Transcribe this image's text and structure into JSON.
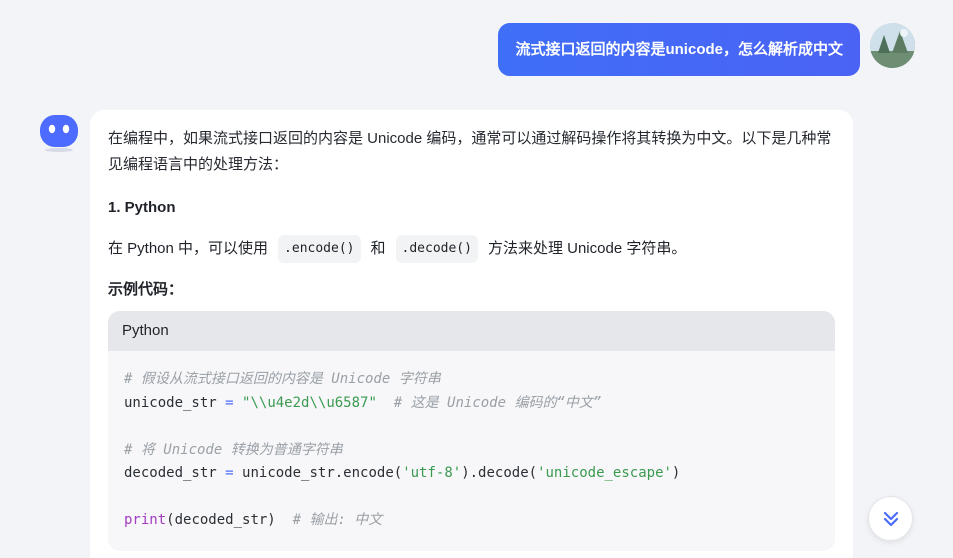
{
  "user_message": "流式接口返回的内容是unicode，怎么解析成中文",
  "answer": {
    "intro": "在编程中，如果流式接口返回的内容是 Unicode 编码，通常可以通过解码操作将其转换为中文。以下是几种常见编程语言中的处理方法：",
    "section_title": "1. Python",
    "desc_prefix": "在 Python 中，可以使用",
    "code_encode": ".encode()",
    "desc_and": "和",
    "code_decode": ".decode()",
    "desc_suffix": "方法来处理 Unicode 字符串。",
    "example_label": "示例代码：",
    "code_block": {
      "language": "Python",
      "line1_comment": "# 假设从流式接口返回的内容是 Unicode 字符串",
      "line2_var": "unicode_str",
      "line2_op": "=",
      "line2_string": "\"\\\\u4e2d\\\\u6587\"",
      "line2_comment": "# 这是 Unicode 编码的“中文”",
      "line4_comment": "# 将 Unicode 转换为普通字符串",
      "line5_var": "decoded_str",
      "line5_op": "=",
      "line5_mid1": "unicode_str.encode(",
      "line5_str1": "'utf-8'",
      "line5_mid2": ").decode(",
      "line5_str2": "'unicode_escape'",
      "line5_end": ")",
      "line7_kw": "print",
      "line7_args": "(decoded_str)",
      "line7_comment": "# 输出: 中文"
    }
  },
  "icons": {
    "bot_avatar": "robot-face-icon",
    "user_avatar": "user-photo-avatar",
    "scroll": "double-chevron-down-icon"
  },
  "colors": {
    "accent": "#4d6bfe",
    "background": "#f3f4f8",
    "string": "#3a9a4f",
    "keyword": "#a43bc0",
    "comment": "#9aa0a6"
  }
}
